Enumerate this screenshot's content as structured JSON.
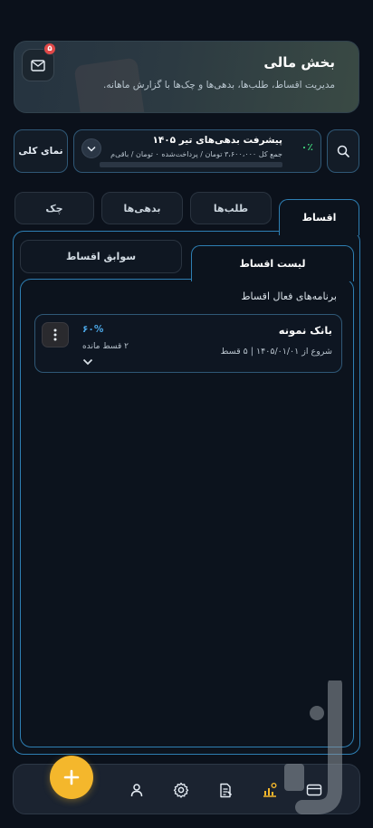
{
  "header": {
    "title": "بخش مالی",
    "subtitle": "مدیریت اقساط، طلب‌ها، بدهی‌ها و چک‌ها با گزارش ماهانه.",
    "mail_badge": "۵",
    "mail_icon": "mail-icon"
  },
  "overview": {
    "button_label": "نمای کلی",
    "progress_title": "پیشرفت بدهی‌های تیر ۱۴۰۵",
    "progress_detail": "جمع کل ۳،۶۰۰،۰۰۰ تومان / پرداخت‌شده ۰ تومان / باقی‌م...",
    "progress_percent": "۰٪",
    "progress_value": 0,
    "accent": "#3fd37a"
  },
  "tabs": {
    "installments": "اقساط",
    "receivables": "طلب‌ها",
    "debts": "بدهی‌ها",
    "cheques": "چک"
  },
  "subtabs": {
    "list": "لیست اقساط",
    "history": "سوابق اقساط"
  },
  "section": {
    "title": "برنامه‌های فعال اقساط"
  },
  "plan": {
    "name": "بانک نمونه",
    "info": "شروع از ۱۴۰۵/۰۱/۰۱ | ۵ قسط",
    "percent": "۶۰%",
    "remaining": "۲ قسط مانده"
  },
  "nav": {
    "items": [
      "card-icon",
      "chart-icon",
      "notes-icon",
      "gear-icon",
      "user-icon"
    ],
    "fab": "plus-icon",
    "active_color": "#f4b72c"
  }
}
